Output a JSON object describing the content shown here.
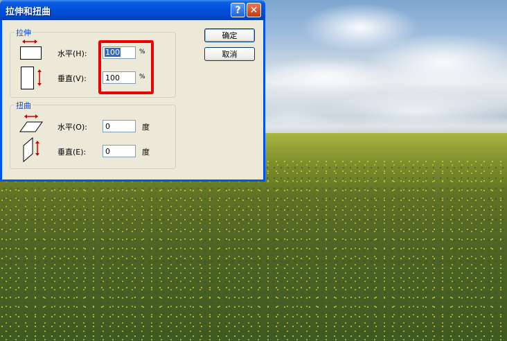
{
  "dialog": {
    "title": "拉伸和扭曲",
    "help_symbol": "?",
    "close_symbol": "✕",
    "ok_label": "确定",
    "cancel_label": "取消"
  },
  "stretch": {
    "group_label": "拉伸",
    "horizontal_label": "水平(H):",
    "horizontal_value": "100",
    "horizontal_unit": "%",
    "vertical_label": "垂直(V):",
    "vertical_value": "100",
    "vertical_unit": "%"
  },
  "skew": {
    "group_label": "扭曲",
    "horizontal_label": "水平(O):",
    "horizontal_value": "0",
    "horizontal_unit": "度",
    "vertical_label": "垂直(E):",
    "vertical_value": "0",
    "vertical_unit": "度"
  },
  "colors": {
    "titlebar": "#0050de",
    "dialog_bg": "#ece9d8",
    "group_label": "#0046d5",
    "highlight": "#ee0000",
    "arrow": "#cc0000"
  }
}
